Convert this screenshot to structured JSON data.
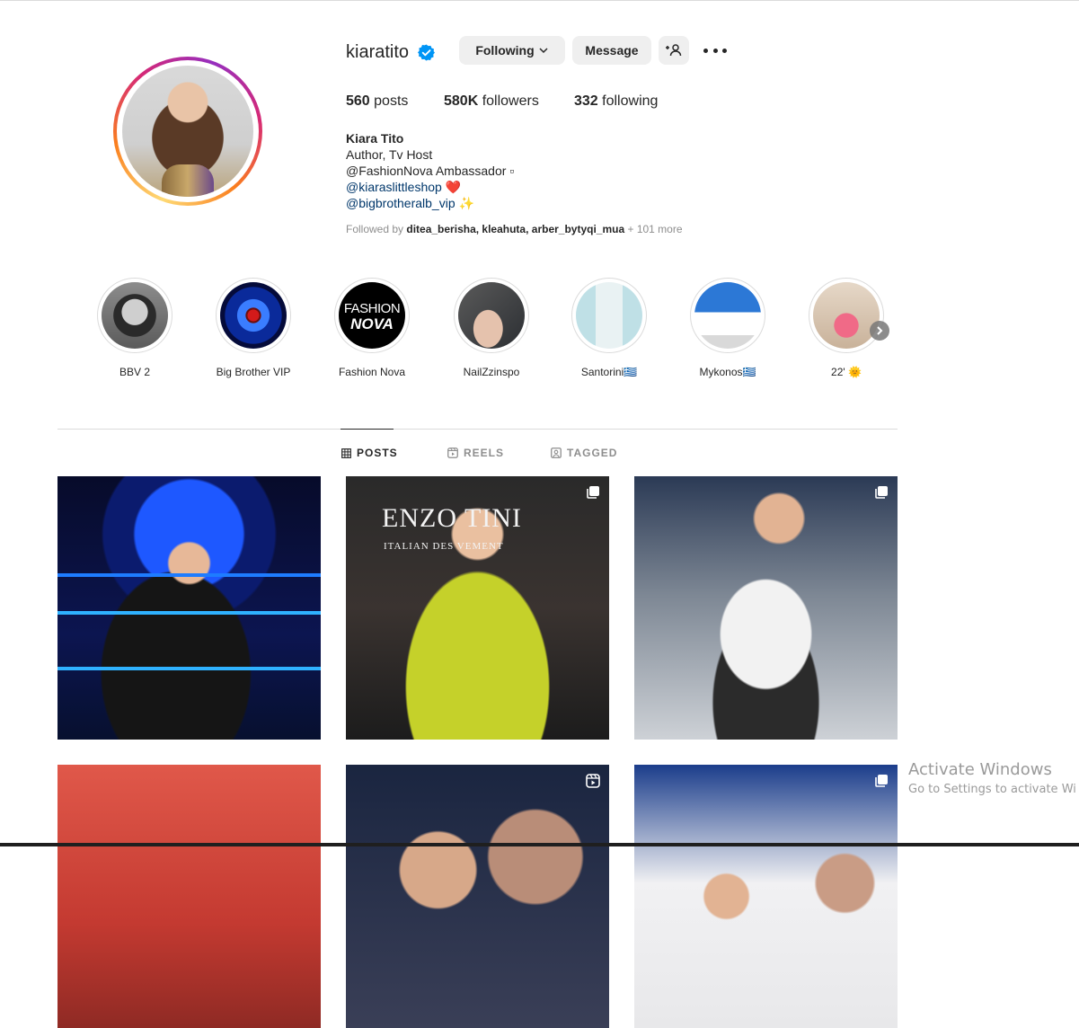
{
  "profile": {
    "username": "kiaratito",
    "buttons": {
      "following": "Following",
      "message": "Message"
    },
    "stats": {
      "posts": "560",
      "posts_label": "posts",
      "followers": "580K",
      "followers_label": "followers",
      "following": "332",
      "following_label": "following"
    },
    "bio": {
      "name": "Kiara Tito",
      "line1": "Author, Tv Host",
      "line2": "@FashionNova Ambassador ▫",
      "link1": "@kiaraslittleshop ❤️",
      "link2": "@bigbrotheralb_vip ✨"
    },
    "followed_by": {
      "prefix": "Followed by ",
      "users": "ditea_berisha, kleahuta, arber_bytyqi_mua",
      "more": " + 101 more"
    }
  },
  "highlights": [
    {
      "label": "BBV 2"
    },
    {
      "label": "Big Brother VIP"
    },
    {
      "label": "Fashion Nova"
    },
    {
      "label": "NailZzinspo"
    },
    {
      "label": "Santorini🇬🇷"
    },
    {
      "label": "Mykonos🇬🇷"
    },
    {
      "label": "22' 🌞"
    }
  ],
  "highlight_art": {
    "fashion_nova_top": "FASHION",
    "fashion_nova_bottom": "NOVA"
  },
  "tabs": [
    {
      "label": "POSTS",
      "icon": "grid-icon"
    },
    {
      "label": "REELS",
      "icon": "reels-icon"
    },
    {
      "label": "TAGGED",
      "icon": "tagged-icon"
    }
  ],
  "post_overlay": {
    "post2_sign_line1": "ENZO  TINI",
    "post2_sign_line2": "ITALIAN DES       VEMENT"
  },
  "system": {
    "activate_title": "Activate Windows",
    "activate_sub": "Go to Settings to activate Wi"
  },
  "colors": {
    "link": "#00376b",
    "verified": "#0095f6",
    "button_bg": "#efefef",
    "muted": "#8e8e8e"
  }
}
